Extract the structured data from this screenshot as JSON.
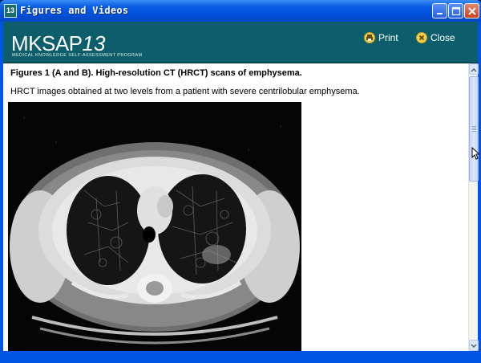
{
  "window": {
    "title": "Figures and Videos",
    "app_icon_text": "13"
  },
  "header": {
    "logo": {
      "main": "MKSAP",
      "number": "13",
      "subtitle": "Medical Knowledge Self-Assessment Program"
    },
    "print_label": "Print",
    "close_label": "Close"
  },
  "content": {
    "figure_title": "Figures 1 (A and B). High-resolution CT (HRCT) scans of emphysema.",
    "figure_description": "HRCT images obtained at two levels from a patient with severe centrilobular emphysema."
  },
  "colors": {
    "titlebar": "#0a5ee6",
    "header_band": "#0d5e6a",
    "icon_yellow": "#f2d04c"
  },
  "icons": [
    "app-icon",
    "minimize-icon",
    "maximize-icon",
    "close-icon",
    "print-icon",
    "close-circle-icon",
    "mouse-cursor-icon"
  ]
}
